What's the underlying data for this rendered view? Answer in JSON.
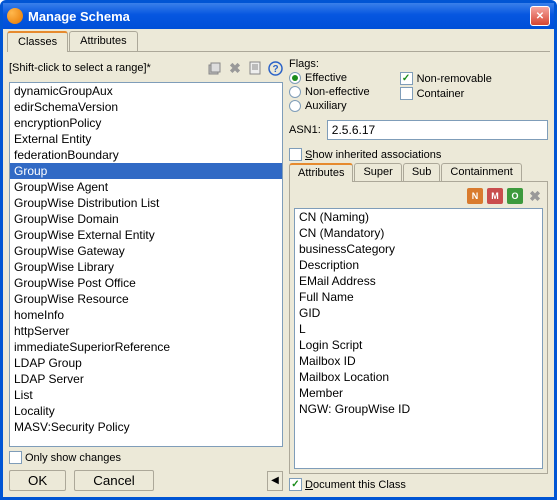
{
  "window": {
    "title": "Manage Schema"
  },
  "mainTabs": [
    {
      "label": "Classes",
      "active": true
    },
    {
      "label": "Attributes",
      "active": false
    }
  ],
  "hint": "[Shift-click to select a range]*",
  "classList": {
    "items": [
      "dynamicGroupAux",
      "edirSchemaVersion",
      "encryptionPolicy",
      "External Entity",
      "federationBoundary",
      "Group",
      "GroupWise Agent",
      "GroupWise Distribution List",
      "GroupWise Domain",
      "GroupWise External Entity",
      "GroupWise Gateway",
      "GroupWise Library",
      "GroupWise Post Office",
      "GroupWise Resource",
      "homeInfo",
      "httpServer",
      "immediateSuperiorReference",
      "LDAP Group",
      "LDAP Server",
      "List",
      "Locality",
      "MASV:Security Policy"
    ],
    "selected": "Group"
  },
  "onlyShowChanges": {
    "label": "Only show changes",
    "checked": false
  },
  "buttons": {
    "ok": "OK",
    "cancel": "Cancel"
  },
  "flags": {
    "label": "Flags:",
    "radios": [
      "Effective",
      "Non-effective",
      "Auxiliary"
    ],
    "radioSelected": "Effective",
    "checks": [
      {
        "label": "Non-removable",
        "checked": true
      },
      {
        "label": "Container",
        "checked": false
      }
    ]
  },
  "asn": {
    "label": "ASN1:",
    "value": "2.5.6.17"
  },
  "showInherited": {
    "label": "Show inherited associations",
    "checked": false
  },
  "subTabs": [
    {
      "label": "Attributes",
      "active": true
    },
    {
      "label": "Super",
      "active": false
    },
    {
      "label": "Sub",
      "active": false
    },
    {
      "label": "Containment",
      "active": false
    }
  ],
  "attributes": [
    "CN (Naming)",
    "CN (Mandatory)",
    "businessCategory",
    "Description",
    "EMail Address",
    "Full Name",
    "GID",
    "L",
    "Login Script",
    "Mailbox ID",
    "Mailbox Location",
    "Member",
    "NGW: GroupWise ID"
  ],
  "documentClass": {
    "label": "Document this Class",
    "checked": true
  }
}
